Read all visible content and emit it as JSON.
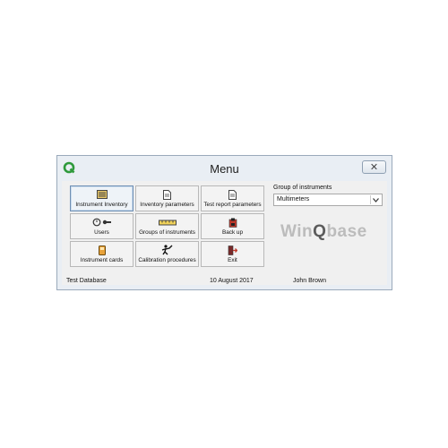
{
  "window": {
    "title": "Menu",
    "close_glyph": "✕",
    "app_icon": "q-logo-icon",
    "accent_color": "#2f9a3c"
  },
  "buttons": [
    {
      "label": "Instrument Inventory",
      "icon": "inventory-icon"
    },
    {
      "label": "Inventory parameters",
      "icon": "document-icon"
    },
    {
      "label": "Test report parameters",
      "icon": "document-icon"
    },
    {
      "label": "Users",
      "icon": "users-key-icon"
    },
    {
      "label": "Groups of instruments",
      "icon": "ruler-icon"
    },
    {
      "label": "Back up",
      "icon": "backup-icon"
    },
    {
      "label": "Instrument cards",
      "icon": "card-icon"
    },
    {
      "label": "Calibration procedures",
      "icon": "procedure-icon"
    },
    {
      "label": "Exit",
      "icon": "exit-icon"
    }
  ],
  "group": {
    "label": "Group of instruments",
    "selected": "Multimeters"
  },
  "logo": {
    "part1": "Win",
    "part2": "Q",
    "part3": "base"
  },
  "status": {
    "database": "Test Database",
    "date": "10 August 2017",
    "user": "John Brown"
  }
}
